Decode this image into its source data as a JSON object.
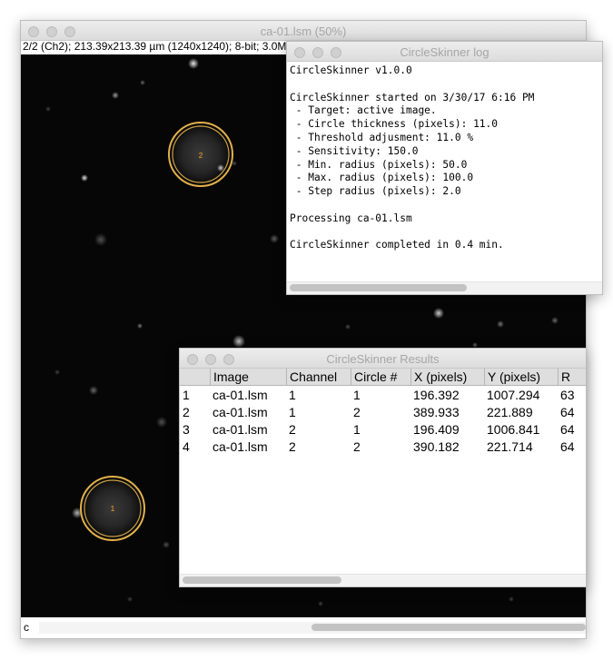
{
  "image_window": {
    "title": "ca-01.lsm (50%)",
    "info": "2/2 (Ch2); 213.39x213.39 µm (1240x1240); 8-bit; 3.0MB",
    "status": "c",
    "circle_labels": [
      "2",
      "1"
    ],
    "circle_color": "#f5a623"
  },
  "log_window": {
    "title": "CircleSkinner log",
    "lines": [
      "CircleSkinner v1.0.0",
      "",
      "CircleSkinner started on 3/30/17 6:16 PM",
      " - Target: active image.",
      " - Circle thickness (pixels): 11.0",
      " - Threshold adjusment: 11.0 %",
      " - Sensitivity: 150.0",
      " - Min. radius (pixels): 50.0",
      " - Max. radius (pixels): 100.0",
      " - Step radius (pixels): 2.0",
      "",
      "Processing ca-01.lsm",
      "",
      "CircleSkinner completed in 0.4 min."
    ]
  },
  "results_window": {
    "title": "CircleSkinner Results",
    "headers": [
      "",
      "Image",
      "Channel",
      "Circle #",
      "X (pixels)",
      "Y (pixels)",
      "R"
    ],
    "rows": [
      [
        "1",
        "ca-01.lsm",
        "1",
        "1",
        "196.392",
        "1007.294",
        "63"
      ],
      [
        "2",
        "ca-01.lsm",
        "1",
        "2",
        "389.933",
        "221.889",
        "64"
      ],
      [
        "3",
        "ca-01.lsm",
        "2",
        "1",
        "196.409",
        "1006.841",
        "64"
      ],
      [
        "4",
        "ca-01.lsm",
        "2",
        "2",
        "390.182",
        "221.714",
        "64"
      ]
    ]
  }
}
